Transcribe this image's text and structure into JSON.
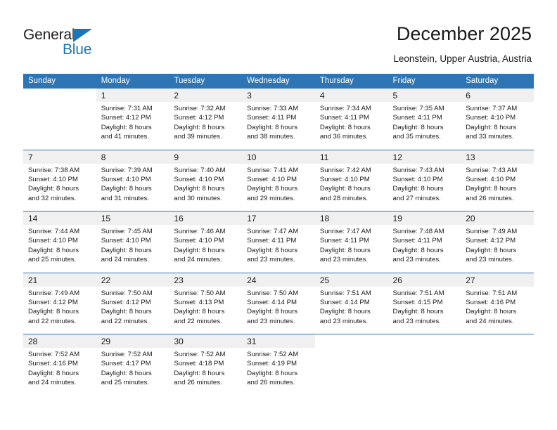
{
  "logo": {
    "word_top": "General",
    "word_bottom": "Blue",
    "triangle_color": "#1b75bb",
    "text_color": "#231f20"
  },
  "header": {
    "title": "December 2025",
    "subtitle": "Leonstein, Upper Austria, Austria"
  },
  "theme": {
    "header_blue": "#2e75b6",
    "daynum_bg": "#f0f0f0",
    "text": "#1a1a1a"
  },
  "calendar": {
    "weekday_headers": [
      "Sunday",
      "Monday",
      "Tuesday",
      "Wednesday",
      "Thursday",
      "Friday",
      "Saturday"
    ],
    "weeks": [
      [
        {
          "day": "",
          "lines": []
        },
        {
          "day": "1",
          "lines": [
            "Sunrise: 7:31 AM",
            "Sunset: 4:12 PM",
            "Daylight: 8 hours",
            "and 41 minutes."
          ]
        },
        {
          "day": "2",
          "lines": [
            "Sunrise: 7:32 AM",
            "Sunset: 4:12 PM",
            "Daylight: 8 hours",
            "and 39 minutes."
          ]
        },
        {
          "day": "3",
          "lines": [
            "Sunrise: 7:33 AM",
            "Sunset: 4:11 PM",
            "Daylight: 8 hours",
            "and 38 minutes."
          ]
        },
        {
          "day": "4",
          "lines": [
            "Sunrise: 7:34 AM",
            "Sunset: 4:11 PM",
            "Daylight: 8 hours",
            "and 36 minutes."
          ]
        },
        {
          "day": "5",
          "lines": [
            "Sunrise: 7:35 AM",
            "Sunset: 4:11 PM",
            "Daylight: 8 hours",
            "and 35 minutes."
          ]
        },
        {
          "day": "6",
          "lines": [
            "Sunrise: 7:37 AM",
            "Sunset: 4:10 PM",
            "Daylight: 8 hours",
            "and 33 minutes."
          ]
        }
      ],
      [
        {
          "day": "7",
          "lines": [
            "Sunrise: 7:38 AM",
            "Sunset: 4:10 PM",
            "Daylight: 8 hours",
            "and 32 minutes."
          ]
        },
        {
          "day": "8",
          "lines": [
            "Sunrise: 7:39 AM",
            "Sunset: 4:10 PM",
            "Daylight: 8 hours",
            "and 31 minutes."
          ]
        },
        {
          "day": "9",
          "lines": [
            "Sunrise: 7:40 AM",
            "Sunset: 4:10 PM",
            "Daylight: 8 hours",
            "and 30 minutes."
          ]
        },
        {
          "day": "10",
          "lines": [
            "Sunrise: 7:41 AM",
            "Sunset: 4:10 PM",
            "Daylight: 8 hours",
            "and 29 minutes."
          ]
        },
        {
          "day": "11",
          "lines": [
            "Sunrise: 7:42 AM",
            "Sunset: 4:10 PM",
            "Daylight: 8 hours",
            "and 28 minutes."
          ]
        },
        {
          "day": "12",
          "lines": [
            "Sunrise: 7:43 AM",
            "Sunset: 4:10 PM",
            "Daylight: 8 hours",
            "and 27 minutes."
          ]
        },
        {
          "day": "13",
          "lines": [
            "Sunrise: 7:43 AM",
            "Sunset: 4:10 PM",
            "Daylight: 8 hours",
            "and 26 minutes."
          ]
        }
      ],
      [
        {
          "day": "14",
          "lines": [
            "Sunrise: 7:44 AM",
            "Sunset: 4:10 PM",
            "Daylight: 8 hours",
            "and 25 minutes."
          ]
        },
        {
          "day": "15",
          "lines": [
            "Sunrise: 7:45 AM",
            "Sunset: 4:10 PM",
            "Daylight: 8 hours",
            "and 24 minutes."
          ]
        },
        {
          "day": "16",
          "lines": [
            "Sunrise: 7:46 AM",
            "Sunset: 4:10 PM",
            "Daylight: 8 hours",
            "and 24 minutes."
          ]
        },
        {
          "day": "17",
          "lines": [
            "Sunrise: 7:47 AM",
            "Sunset: 4:11 PM",
            "Daylight: 8 hours",
            "and 23 minutes."
          ]
        },
        {
          "day": "18",
          "lines": [
            "Sunrise: 7:47 AM",
            "Sunset: 4:11 PM",
            "Daylight: 8 hours",
            "and 23 minutes."
          ]
        },
        {
          "day": "19",
          "lines": [
            "Sunrise: 7:48 AM",
            "Sunset: 4:11 PM",
            "Daylight: 8 hours",
            "and 23 minutes."
          ]
        },
        {
          "day": "20",
          "lines": [
            "Sunrise: 7:49 AM",
            "Sunset: 4:12 PM",
            "Daylight: 8 hours",
            "and 23 minutes."
          ]
        }
      ],
      [
        {
          "day": "21",
          "lines": [
            "Sunrise: 7:49 AM",
            "Sunset: 4:12 PM",
            "Daylight: 8 hours",
            "and 22 minutes."
          ]
        },
        {
          "day": "22",
          "lines": [
            "Sunrise: 7:50 AM",
            "Sunset: 4:12 PM",
            "Daylight: 8 hours",
            "and 22 minutes."
          ]
        },
        {
          "day": "23",
          "lines": [
            "Sunrise: 7:50 AM",
            "Sunset: 4:13 PM",
            "Daylight: 8 hours",
            "and 22 minutes."
          ]
        },
        {
          "day": "24",
          "lines": [
            "Sunrise: 7:50 AM",
            "Sunset: 4:14 PM",
            "Daylight: 8 hours",
            "and 23 minutes."
          ]
        },
        {
          "day": "25",
          "lines": [
            "Sunrise: 7:51 AM",
            "Sunset: 4:14 PM",
            "Daylight: 8 hours",
            "and 23 minutes."
          ]
        },
        {
          "day": "26",
          "lines": [
            "Sunrise: 7:51 AM",
            "Sunset: 4:15 PM",
            "Daylight: 8 hours",
            "and 23 minutes."
          ]
        },
        {
          "day": "27",
          "lines": [
            "Sunrise: 7:51 AM",
            "Sunset: 4:16 PM",
            "Daylight: 8 hours",
            "and 24 minutes."
          ]
        }
      ],
      [
        {
          "day": "28",
          "lines": [
            "Sunrise: 7:52 AM",
            "Sunset: 4:16 PM",
            "Daylight: 8 hours",
            "and 24 minutes."
          ]
        },
        {
          "day": "29",
          "lines": [
            "Sunrise: 7:52 AM",
            "Sunset: 4:17 PM",
            "Daylight: 8 hours",
            "and 25 minutes."
          ]
        },
        {
          "day": "30",
          "lines": [
            "Sunrise: 7:52 AM",
            "Sunset: 4:18 PM",
            "Daylight: 8 hours",
            "and 26 minutes."
          ]
        },
        {
          "day": "31",
          "lines": [
            "Sunrise: 7:52 AM",
            "Sunset: 4:19 PM",
            "Daylight: 8 hours",
            "and 26 minutes."
          ]
        },
        {
          "day": "",
          "lines": []
        },
        {
          "day": "",
          "lines": []
        },
        {
          "day": "",
          "lines": []
        }
      ]
    ]
  }
}
